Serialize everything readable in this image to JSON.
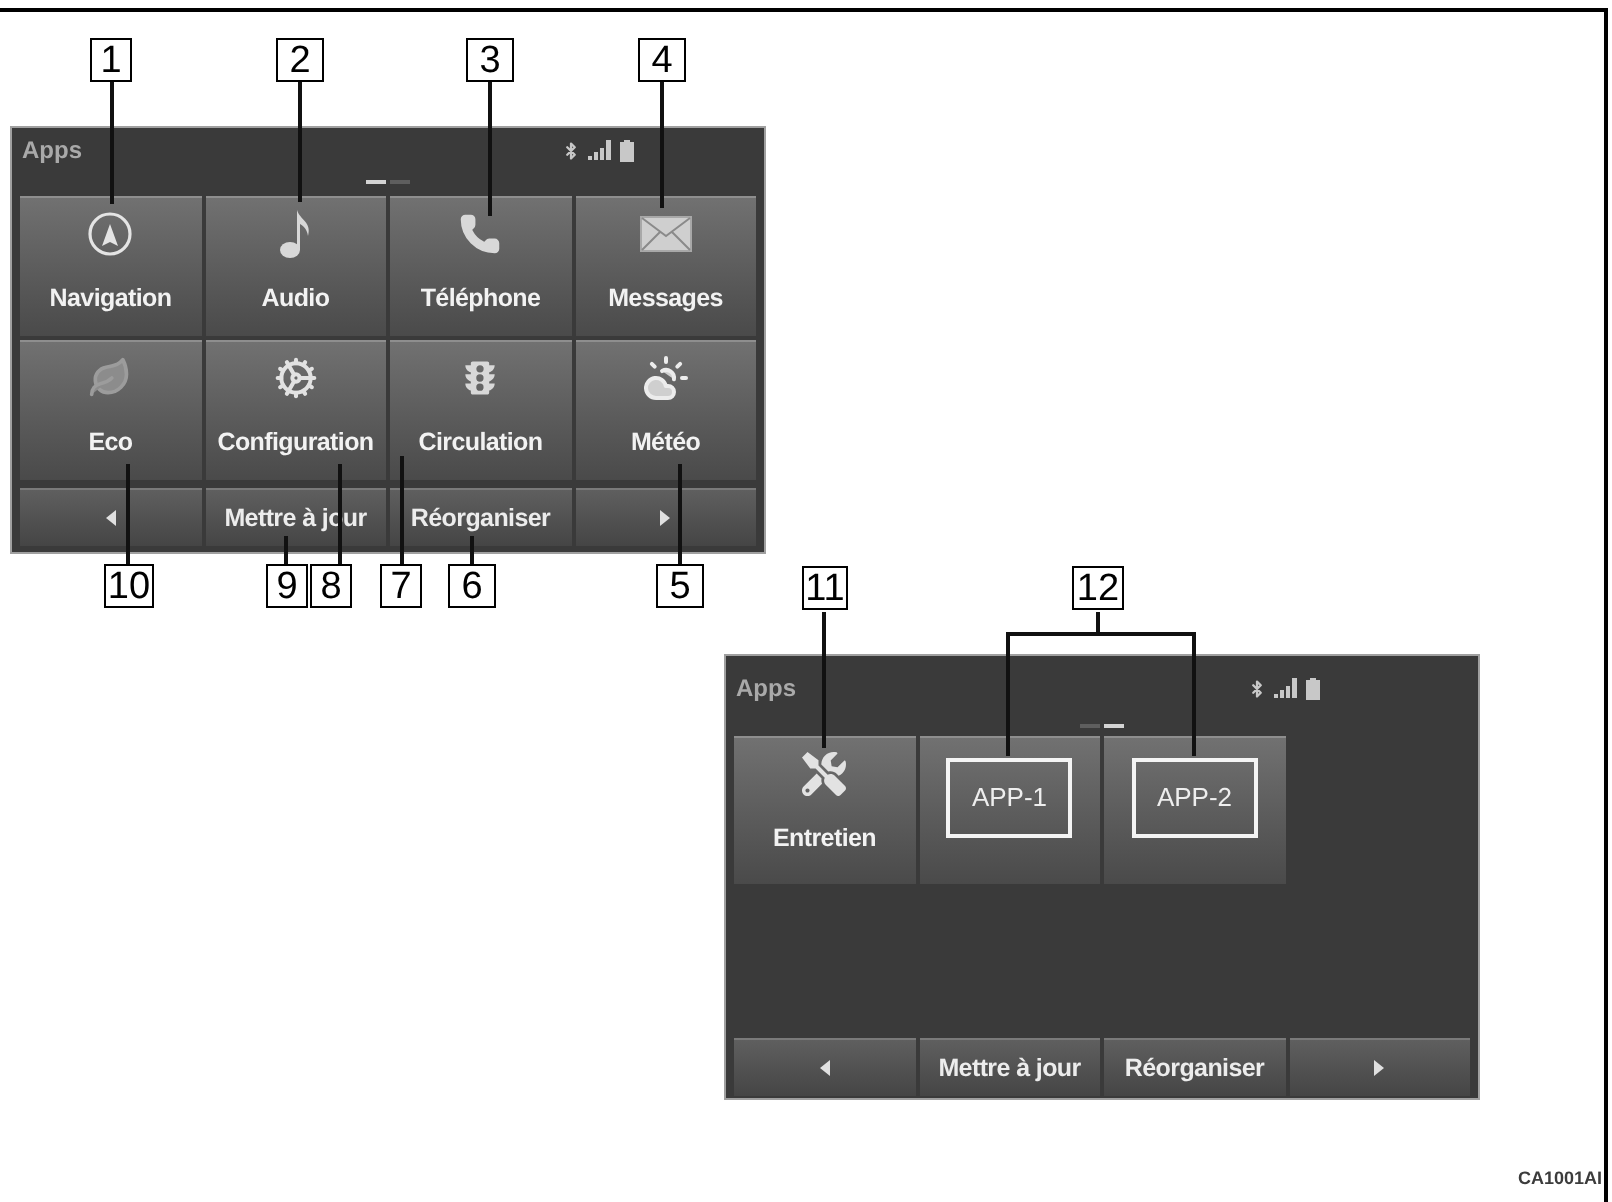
{
  "screens": [
    {
      "title": "Apps",
      "pages": [
        {
          "selected": true
        },
        {
          "selected": false
        }
      ],
      "tiles": [
        {
          "kind": "icon",
          "label": "Navigation"
        },
        {
          "kind": "icon",
          "label": "Audio"
        },
        {
          "kind": "icon",
          "label": "Téléphone"
        },
        {
          "kind": "icon",
          "label": "Messages"
        },
        {
          "kind": "icon",
          "label": "Eco"
        },
        {
          "kind": "icon",
          "label": "Configuration"
        },
        {
          "kind": "icon",
          "label": "Circulation"
        },
        {
          "kind": "icon",
          "label": "Météo"
        }
      ],
      "bar_labels": [
        "Mettre à jour",
        "Réorganiser"
      ]
    },
    {
      "title": "Apps",
      "pages": [
        {
          "selected": false
        },
        {
          "selected": true
        }
      ],
      "tiles": [
        {
          "kind": "icon",
          "label": "Entretien"
        },
        {
          "kind": "app",
          "label": "APP-1"
        },
        {
          "kind": "app",
          "label": "APP-2"
        }
      ],
      "bar_labels": [
        "Mettre à jour",
        "Réorganiser"
      ]
    }
  ],
  "callouts": [
    "1",
    "2",
    "3",
    "4",
    "10",
    "9",
    "8",
    "7",
    "6",
    "5",
    "11",
    "12"
  ],
  "figure_code": "CA1001AI"
}
